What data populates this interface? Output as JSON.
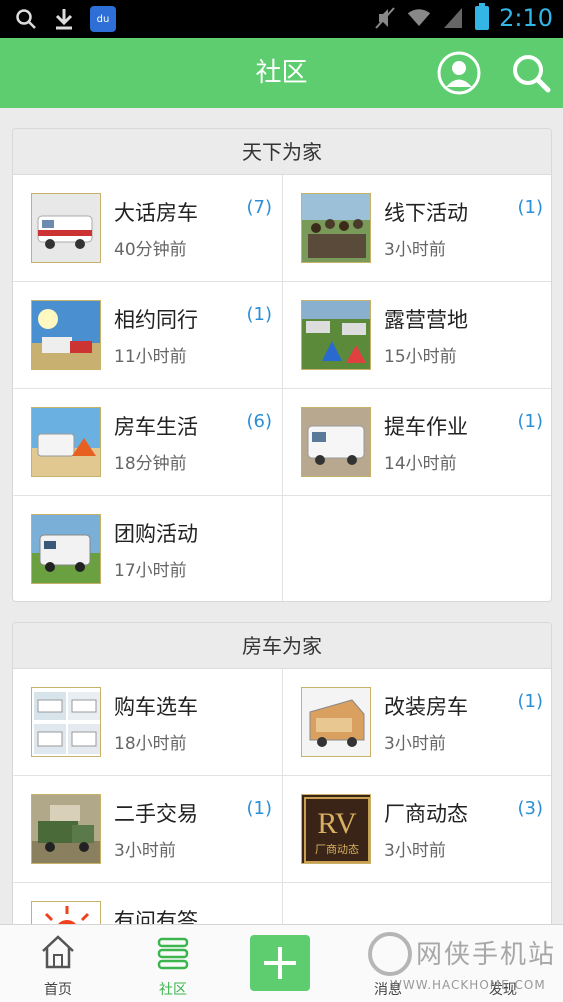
{
  "status_bar": {
    "time": "2:10",
    "baidu_text": "du"
  },
  "header": {
    "title": "社区"
  },
  "sections": [
    {
      "title": "天下为家",
      "items": [
        {
          "name": "大话房车",
          "time": "40分钟前",
          "count": "(7)"
        },
        {
          "name": "线下活动",
          "time": "3小时前",
          "count": "(1)"
        },
        {
          "name": "相约同行",
          "time": "11小时前",
          "count": "(1)"
        },
        {
          "name": "露营营地",
          "time": "15小时前",
          "count": ""
        },
        {
          "name": "房车生活",
          "time": "18分钟前",
          "count": "(6)"
        },
        {
          "name": "提车作业",
          "time": "14小时前",
          "count": "(1)"
        },
        {
          "name": "团购活动",
          "time": "17小时前",
          "count": ""
        }
      ]
    },
    {
      "title": "房车为家",
      "items": [
        {
          "name": "购车选车",
          "time": "18小时前",
          "count": ""
        },
        {
          "name": "改装房车",
          "time": "3小时前",
          "count": "(1)"
        },
        {
          "name": "二手交易",
          "time": "3小时前",
          "count": "(1)"
        },
        {
          "name": "厂商动态",
          "time": "3小时前",
          "count": "(3)"
        },
        {
          "name": "有问有答",
          "time": "",
          "count": ""
        }
      ]
    }
  ],
  "thumb_text": {
    "rv": "RV",
    "rv_sub": "厂商动态"
  },
  "bottom_nav": [
    {
      "label": "首页"
    },
    {
      "label": "社区"
    },
    {
      "label": ""
    },
    {
      "label": "消息"
    },
    {
      "label": "发现"
    }
  ],
  "watermark": {
    "big": "网侠手机站",
    "small": "WWW.HACKHOME.COM"
  },
  "colors": {
    "accent_green": "#5dcd6f",
    "count_blue": "#2a8fd6",
    "status_blue": "#33b5e5"
  }
}
